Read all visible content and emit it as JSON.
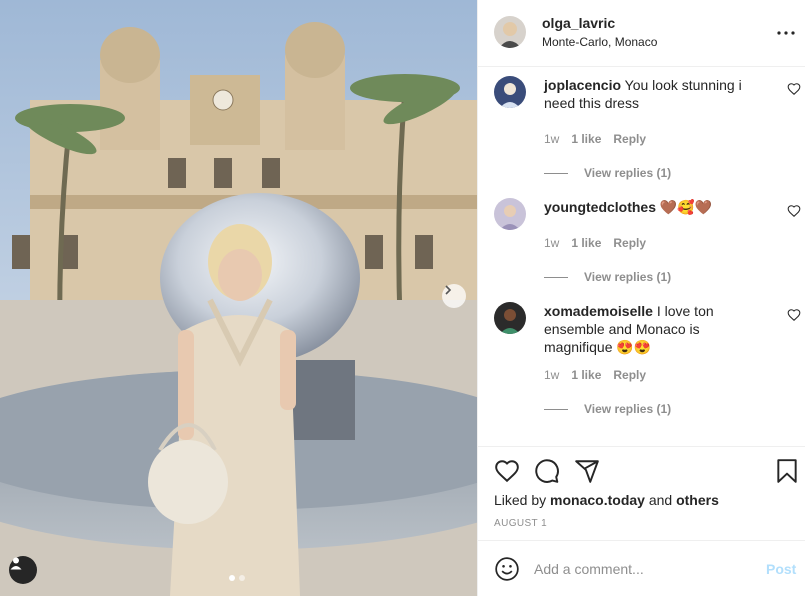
{
  "post": {
    "username": "olga_lavric",
    "location": "Monte-Carlo, Monaco",
    "photo_page_dots": 2,
    "photo_active_dot": 1
  },
  "comments": [
    {
      "username": "joplacencio",
      "text": " You look stunning i need this dress",
      "age": "1w",
      "likes": "1 like",
      "reply": "Reply",
      "view_replies": "View replies (1)"
    },
    {
      "username": "youngtedclothes",
      "text": " 🤎🥰🤎",
      "age": "1w",
      "likes": "1 like",
      "reply": "Reply",
      "view_replies": "View replies (1)"
    },
    {
      "username": "xomademoiselle",
      "text": " I love ton ensemble and Monaco is magnifique 😍😍",
      "age": "1w",
      "likes": "1 like",
      "reply": "Reply",
      "view_replies": "View replies (1)"
    }
  ],
  "actions": {
    "liked_by_prefix": "Liked by ",
    "liked_by_user": "monaco.today",
    "liked_by_and": " and ",
    "liked_by_others": "others",
    "date": "AUGUST 1"
  },
  "add_comment": {
    "placeholder": "Add a comment...",
    "post_label": "Post"
  },
  "colors": {
    "post_button": "#b2dffc",
    "secondary_text": "#8e8e8e",
    "primary_text": "#262626"
  },
  "icons": [
    "more-icon",
    "heart-icon",
    "comment-icon",
    "share-icon",
    "bookmark-icon",
    "emoji-icon",
    "chevron-right-icon",
    "user-tag-icon"
  ]
}
